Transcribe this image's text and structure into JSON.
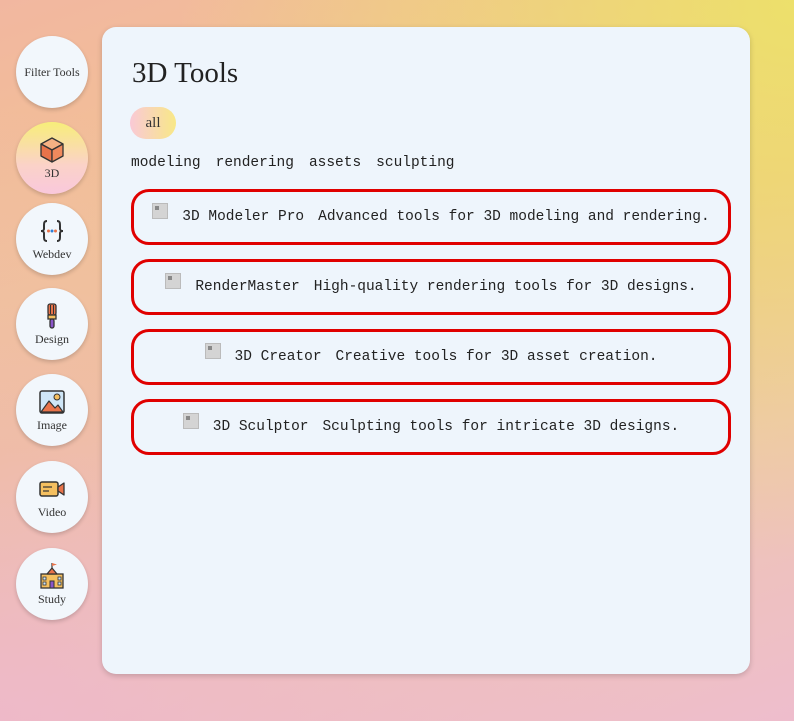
{
  "sidebar": {
    "items": [
      {
        "label": "Filter Tools",
        "icon": "filter-tools-text",
        "active": false
      },
      {
        "label": "3D",
        "icon": "cube-icon",
        "active": true
      },
      {
        "label": "Webdev",
        "icon": "code-braces-icon",
        "active": false
      },
      {
        "label": "Design",
        "icon": "paintbrush-icon",
        "active": false
      },
      {
        "label": "Image",
        "icon": "image-icon",
        "active": false
      },
      {
        "label": "Video",
        "icon": "video-camera-icon",
        "active": false
      },
      {
        "label": "Study",
        "icon": "school-building-icon",
        "active": false
      }
    ]
  },
  "main": {
    "title": "3D Tools",
    "filter_pill": "all",
    "tags": [
      "modeling",
      "rendering",
      "assets",
      "sculpting"
    ],
    "tools": [
      {
        "name": "3D Modeler Pro",
        "description": "Advanced tools for 3D modeling and rendering."
      },
      {
        "name": "RenderMaster",
        "description": "High-quality rendering tools for 3D designs."
      },
      {
        "name": "3D Creator",
        "description": "Creative tools for 3D asset creation."
      },
      {
        "name": "3D Sculptor",
        "description": "Sculpting tools for intricate 3D designs."
      }
    ]
  },
  "colors": {
    "card_border": "#e00000",
    "panel_bg": "#eef5fc",
    "active_gradient_top": "#f7ee7a",
    "active_gradient_bottom": "#f9c8dc"
  }
}
